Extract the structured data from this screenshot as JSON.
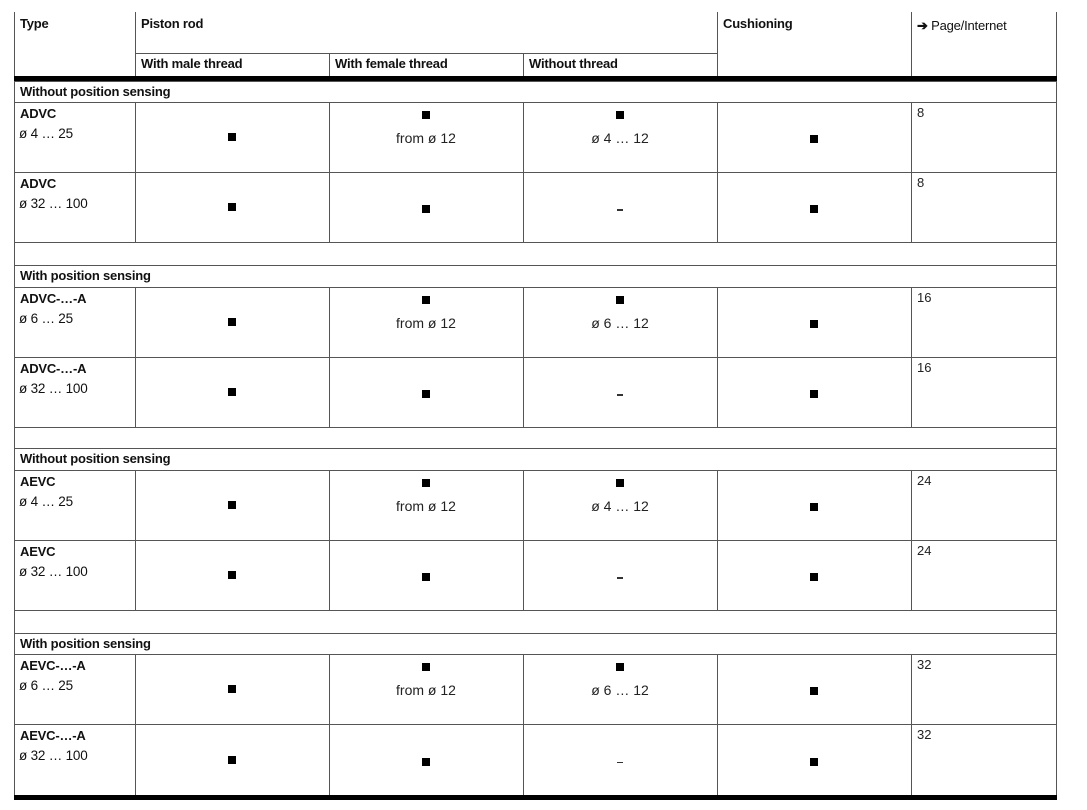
{
  "header": {
    "type": "Type",
    "piston_rod": "Piston rod",
    "male": "With male thread",
    "female": "With female thread",
    "without": "Without thread",
    "cushioning": "Cushioning",
    "page_arrow": "➔",
    "page": "Page/Internet"
  },
  "symbols": {
    "available": "■",
    "not_available": "–"
  },
  "sections": [
    {
      "title": "Without position sensing",
      "rows": [
        {
          "type": "ADVC",
          "range": "ø 4 … 25",
          "male": "■",
          "female": "■",
          "female_note": "from ø 12",
          "without": "■",
          "without_note": "ø 4 … 12",
          "cushioning": "■",
          "page": "8"
        },
        {
          "type": "ADVC",
          "range": "ø 32 … 100",
          "male": "■",
          "female": "■",
          "female_note": "",
          "without": "–",
          "without_note": "",
          "cushioning": "■",
          "page": "8"
        }
      ]
    },
    {
      "title": "With position sensing",
      "rows": [
        {
          "type": "ADVC-…-A",
          "range": "ø 6 … 25",
          "male": "■",
          "female": "■",
          "female_note": "from ø 12",
          "without": "■",
          "without_note": "ø 6 … 12",
          "cushioning": "■",
          "page": "16"
        },
        {
          "type": "ADVC-…-A",
          "range": "ø 32 … 100",
          "male": "■",
          "female": "■",
          "female_note": "",
          "without": "–",
          "without_note": "",
          "cushioning": "■",
          "page": "16"
        }
      ]
    },
    {
      "title": "Without position sensing",
      "rows": [
        {
          "type": "AEVC",
          "range": "ø 4 … 25",
          "male": "■",
          "female": "■",
          "female_note": "from ø 12",
          "without": "■",
          "without_note": "ø 4 … 12",
          "cushioning": "■",
          "page": "24"
        },
        {
          "type": "AEVC",
          "range": "ø 32 … 100",
          "male": "■",
          "female": "■",
          "female_note": "",
          "without": "–",
          "without_note": "",
          "cushioning": "■",
          "page": "24"
        }
      ]
    },
    {
      "title": "With position sensing",
      "rows": [
        {
          "type": "AEVC-…-A",
          "range": "ø 6 … 25",
          "male": "■",
          "female": "■",
          "female_note": "from ø 12",
          "without": "■",
          "without_note": "ø 6 … 12",
          "cushioning": "■",
          "page": "32"
        },
        {
          "type": "AEVC-…-A",
          "range": "ø 32 … 100",
          "male": "■",
          "female": "■",
          "female_note": "",
          "without": "–",
          "without_note": "",
          "cushioning": "■",
          "page": "32"
        }
      ]
    }
  ]
}
